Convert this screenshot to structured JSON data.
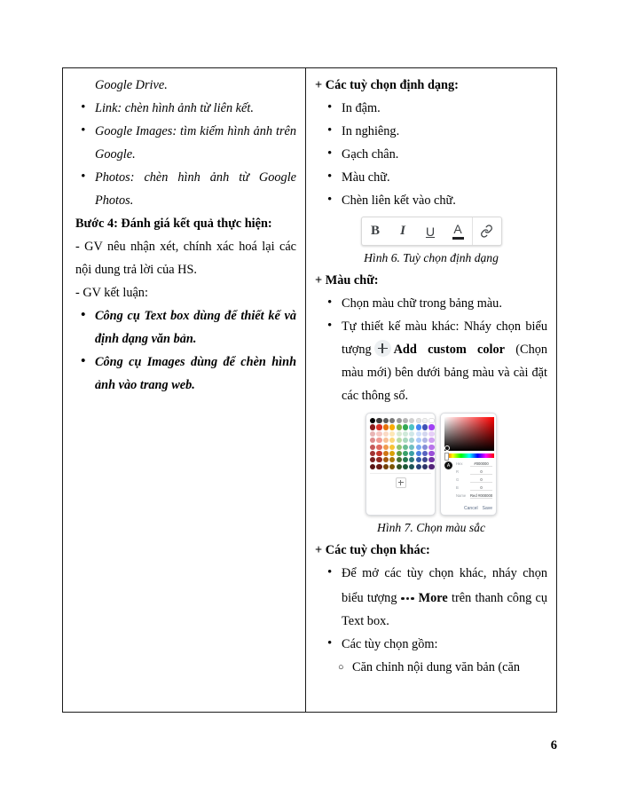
{
  "document": {
    "page_number": "6",
    "left_column": {
      "continuation_line": "Google Drive.",
      "bullets": [
        "Link: chèn hình ảnh từ liên kết.",
        "Google Images: tìm kiếm hình ảnh trên Google.",
        "Photos: chèn hình ảnh từ Google Photos."
      ],
      "step_heading": "Bước 4: Đánh giá kết quả thực hiện:",
      "dash_lines": [
        "- GV nêu nhận xét, chính xác hoá lại các nội dung trả lời của HS.",
        "- GV kết luận:"
      ],
      "conclusion_bullets": [
        "Công cụ Text box dùng để thiết kế và định dạng văn bản.",
        "Công cụ Images dùng để chèn hình ảnh vào trang web."
      ]
    },
    "right_column": {
      "heading_format_options": "+ Các tuỳ chọn định dạng:",
      "format_bullets": [
        "In đậm.",
        "In nghiêng.",
        "Gạch chân.",
        "Màu chữ.",
        "Chèn liên kết vào chữ."
      ],
      "figure6": {
        "caption": "Hình 6. Tuỳ chọn định dạng",
        "toolbar_buttons": [
          {
            "name": "bold-button",
            "glyph": "B"
          },
          {
            "name": "italic-button",
            "glyph": "I"
          },
          {
            "name": "underline-button",
            "glyph": "U"
          },
          {
            "name": "text-color-button",
            "glyph": "A"
          },
          {
            "name": "insert-link-button",
            "glyph": "link"
          }
        ]
      },
      "heading_text_color": "+ Màu chữ:",
      "color_bullet_1": "Chọn màu chữ trong bảng màu.",
      "color_bullet_2": {
        "part1": "Tự thiết kế màu khác: Nháy chọn biểu tượng",
        "icon": "plus-icon",
        "bold_label": "Add custom color",
        "part2": "(Chọn màu mới) bên dưới bảng màu và cài đặt các thông số."
      },
      "figure7": {
        "caption": "Hình 7. Chọn màu sắc",
        "picker": {
          "hex_label": "Hex",
          "hex_value": "#000000",
          "r_label": "R",
          "r_value": "0",
          "g_label": "G",
          "g_value": "0",
          "b_label": "B",
          "b_value": "0",
          "name_label": "Name",
          "name_value": "Red #000000",
          "cancel_label": "Cancel",
          "save_label": "Save",
          "swatch_rows": [
            [
              "#000000",
              "#3c3c3c",
              "#5a5a5a",
              "#787878",
              "#9a9a9a",
              "#b4b4b4",
              "#cfcfcf",
              "#e2e2e2",
              "#f1f1f1",
              "#ffffff"
            ],
            [
              "#8b1a1a",
              "#d93025",
              "#e8710a",
              "#f9ab00",
              "#7cb342",
              "#34a853",
              "#4cc2c4",
              "#4285f4",
              "#3f51b5",
              "#a142f4"
            ],
            [
              "#e8b4b4",
              "#f6c7c3",
              "#fbd9c3",
              "#fde7b5",
              "#d9ead3",
              "#cfe9d9",
              "#cfe7e8",
              "#cfe0fb",
              "#d3d6ef",
              "#e6cff8"
            ],
            [
              "#dd8b8b",
              "#ef9a93",
              "#f7bf95",
              "#fbd677",
              "#b9dca4",
              "#a8d8bd",
              "#a2d2d5",
              "#a9c8f8",
              "#b0b6e4",
              "#cfa0f1"
            ],
            [
              "#c55a5a",
              "#e06a60",
              "#f09a4e",
              "#f8c436",
              "#8fc470",
              "#6bbd92",
              "#6fbec2",
              "#7aa9f2",
              "#858ed6",
              "#b874ea"
            ],
            [
              "#a13232",
              "#c5362c",
              "#cf7514",
              "#d9a006",
              "#5f9b3f",
              "#38a169",
              "#3aa0a6",
              "#4a7fe0",
              "#5862c0",
              "#9a4fd8"
            ],
            [
              "#7a1f1f",
              "#92271f",
              "#a2560c",
              "#a87604",
              "#457030",
              "#25784d",
              "#2a767c",
              "#3459a8",
              "#3e478f",
              "#7132a6"
            ],
            [
              "#5a1414",
              "#6a1a14",
              "#734008",
              "#7a5503",
              "#325222",
              "#1a5636",
              "#1e5459",
              "#254079",
              "#2d3468",
              "#522478"
            ]
          ]
        }
      },
      "heading_other_options": "+ Các tuỳ chọn khác:",
      "other_bullet_1": {
        "part1": "Để mở các tùy chọn khác, nháy chọn biểu tượng",
        "icon": "more-icon",
        "bold_label": "More",
        "part2": "trên thanh công cụ Text box."
      },
      "other_bullet_2": "Các tùy chọn gồm:",
      "sub_bullet_1": "Căn chỉnh nội dung văn bản (căn"
    }
  }
}
